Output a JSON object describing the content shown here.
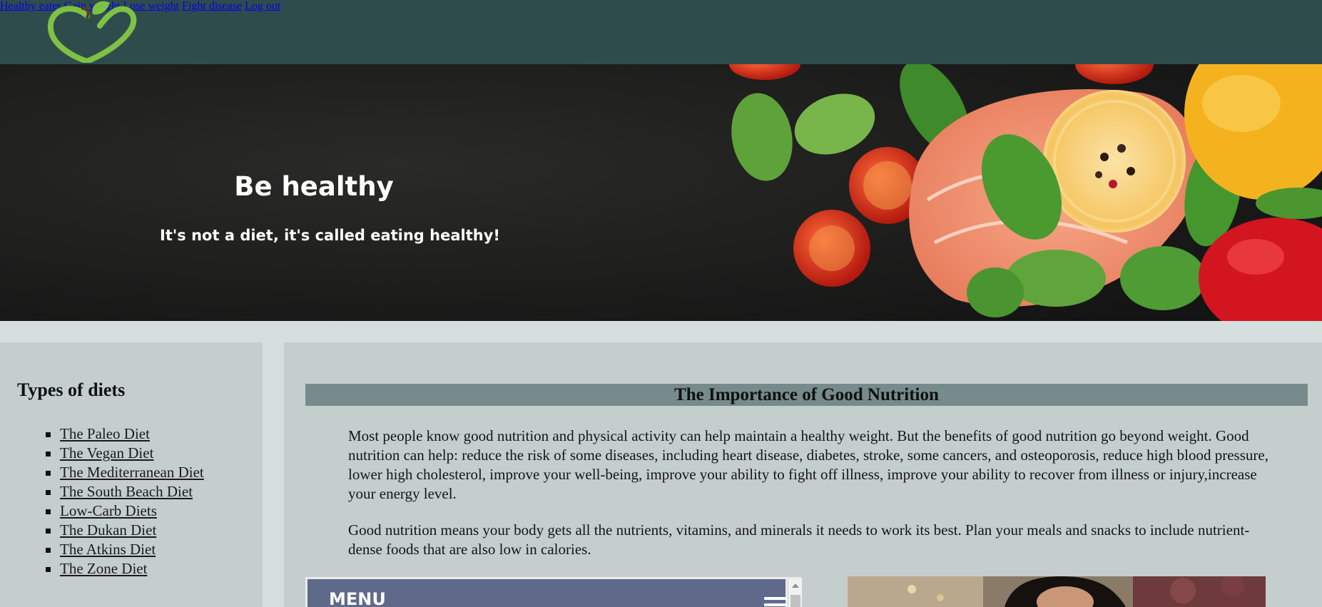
{
  "nav": {
    "items": [
      {
        "label": "Healthy eater"
      },
      {
        "label": "Gain weight"
      },
      {
        "label": "Lose weight"
      },
      {
        "label": "Fight disease"
      },
      {
        "label": "Log out"
      }
    ]
  },
  "hero": {
    "title": "Be healthy",
    "subtitle": "It's not a diet, it's called eating healthy!"
  },
  "sidebar": {
    "heading": "Types of diets",
    "items": [
      {
        "label": "The Paleo Diet"
      },
      {
        "label": "The Vegan Diet"
      },
      {
        "label": "The Mediterranean Diet"
      },
      {
        "label": "The South Beach Diet"
      },
      {
        "label": "Low-Carb Diets"
      },
      {
        "label": "The Dukan Diet"
      },
      {
        "label": "The Atkins Diet"
      },
      {
        "label": "The Zone Diet"
      }
    ]
  },
  "main": {
    "title": "The Importance of Good Nutrition",
    "paragraph1": "Most people know good nutrition and physical activity can help maintain a healthy weight. But the benefits of good nutrition go beyond weight. Good nutrition can help: reduce the risk of some diseases, including heart disease, diabetes, stroke, some cancers, and osteoporosis, reduce high blood pressure, lower high cholesterol, improve your well-being, improve your ability to fight off illness, improve your ability to recover from illness or injury,increase your energy level.",
    "paragraph2": "Good nutrition means your body gets all the nutrients, vitamins, and minerals it needs to work its best. Plan your meals and snacks to include nutrient-dense foods that are also low in calories."
  },
  "widget": {
    "label": "MENU"
  },
  "colors": {
    "header_bg": "#2f4c4d",
    "logo_green": "#7dc242",
    "panel_bg": "#c4cfcd",
    "title_bar": "#778b8c",
    "widget_bg": "#5f6a8a"
  },
  "icons": {
    "logo": "apple-heart-logo-icon",
    "menu": "hamburger-icon"
  }
}
